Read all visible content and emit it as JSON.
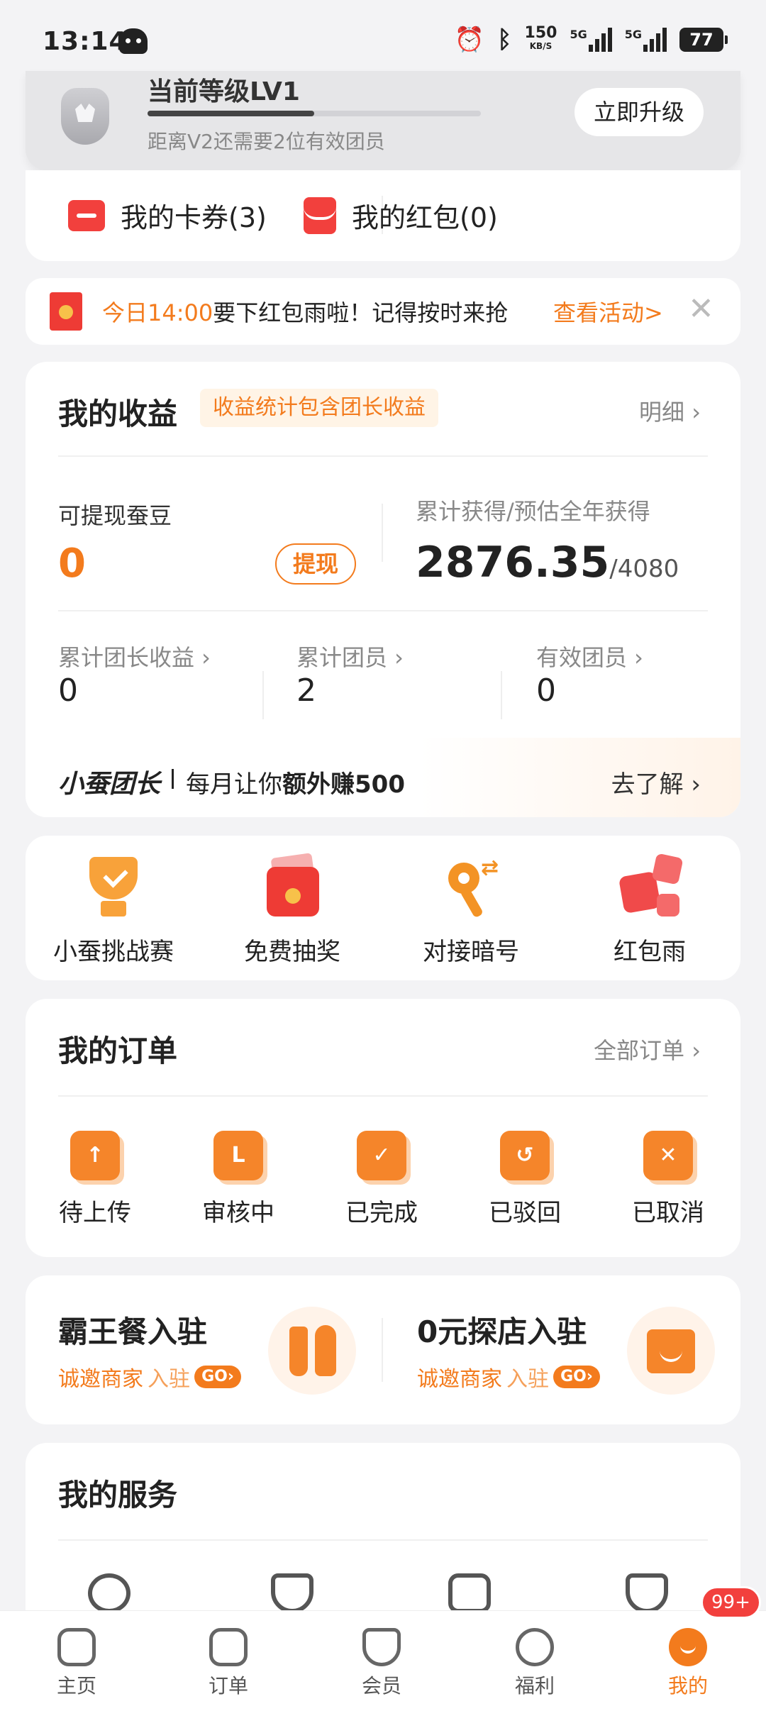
{
  "status_bar": {
    "time": "13:14",
    "net_speed": "150",
    "net_unit": "KB/S",
    "sig1": "5G",
    "sig2": "5G",
    "battery": "77"
  },
  "level": {
    "title": "当前等级LV1",
    "progress": 0.5,
    "tip": "距离V2还需要2位有效团员",
    "upgrade_label": "立即升级"
  },
  "cards": {
    "coupons_label": "我的卡券(3)",
    "redpacket_label": "我的红包(0)"
  },
  "notice": {
    "time": "今日14:00",
    "text": "要下红包雨啦！记得按时来抢",
    "action": "查看活动>",
    "close": "✕"
  },
  "income": {
    "title": "我的收益",
    "tag": "收益统计包含团长收益",
    "detail": "明细 ›",
    "withdrawable_label": "可提现蚕豆",
    "withdrawable_value": "0",
    "withdraw_button": "提现",
    "total_label": "累计获得/预估全年获得",
    "total_value": "2876.35",
    "total_estimate": "/4080",
    "stats": [
      {
        "label": "累计团长收益 ›",
        "value": "0"
      },
      {
        "label": "累计团员 ›",
        "value": "2"
      },
      {
        "label": "有效团员 ›",
        "value": "0"
      }
    ],
    "captain": {
      "brand": "小蚕团长",
      "text_pre": "每月让你",
      "text_bold": "额外赚500",
      "action": "去了解 ›"
    }
  },
  "quick": [
    {
      "label": "小蚕挑战赛",
      "icon": "trophy-icon"
    },
    {
      "label": "免费抽奖",
      "icon": "gift-box-icon"
    },
    {
      "label": "对接暗号",
      "icon": "key-icon"
    },
    {
      "label": "红包雨",
      "icon": "red-packet-rain-icon"
    }
  ],
  "orders": {
    "title": "我的订单",
    "all": "全部订单 ›",
    "items": [
      {
        "label": "待上传",
        "icon": "upload-icon",
        "glyph": "↑"
      },
      {
        "label": "审核中",
        "icon": "clock-icon",
        "glyph": "L"
      },
      {
        "label": "已完成",
        "icon": "check-icon",
        "glyph": "✓"
      },
      {
        "label": "已驳回",
        "icon": "return-icon",
        "glyph": "↺"
      },
      {
        "label": "已取消",
        "icon": "cancel-icon",
        "glyph": "✕"
      }
    ]
  },
  "merchant": [
    {
      "title": "霸王餐入驻",
      "sub_a": "诚邀商家",
      "sub_b": "入驻",
      "go": "GO›",
      "icon": "fork-spoon-icon"
    },
    {
      "title": "0元探店入驻",
      "sub_a": "诚邀商家",
      "sub_b": "入驻",
      "go": "GO›",
      "icon": "shop-icon"
    }
  ],
  "services": {
    "title": "我的服务"
  },
  "tabbar": {
    "items": [
      {
        "label": "主页",
        "icon": "home-icon"
      },
      {
        "label": "订单",
        "icon": "order-icon"
      },
      {
        "label": "会员",
        "icon": "member-icon"
      },
      {
        "label": "福利",
        "icon": "welfare-icon"
      },
      {
        "label": "我的",
        "icon": "profile-icon"
      }
    ],
    "badge": "99+"
  }
}
